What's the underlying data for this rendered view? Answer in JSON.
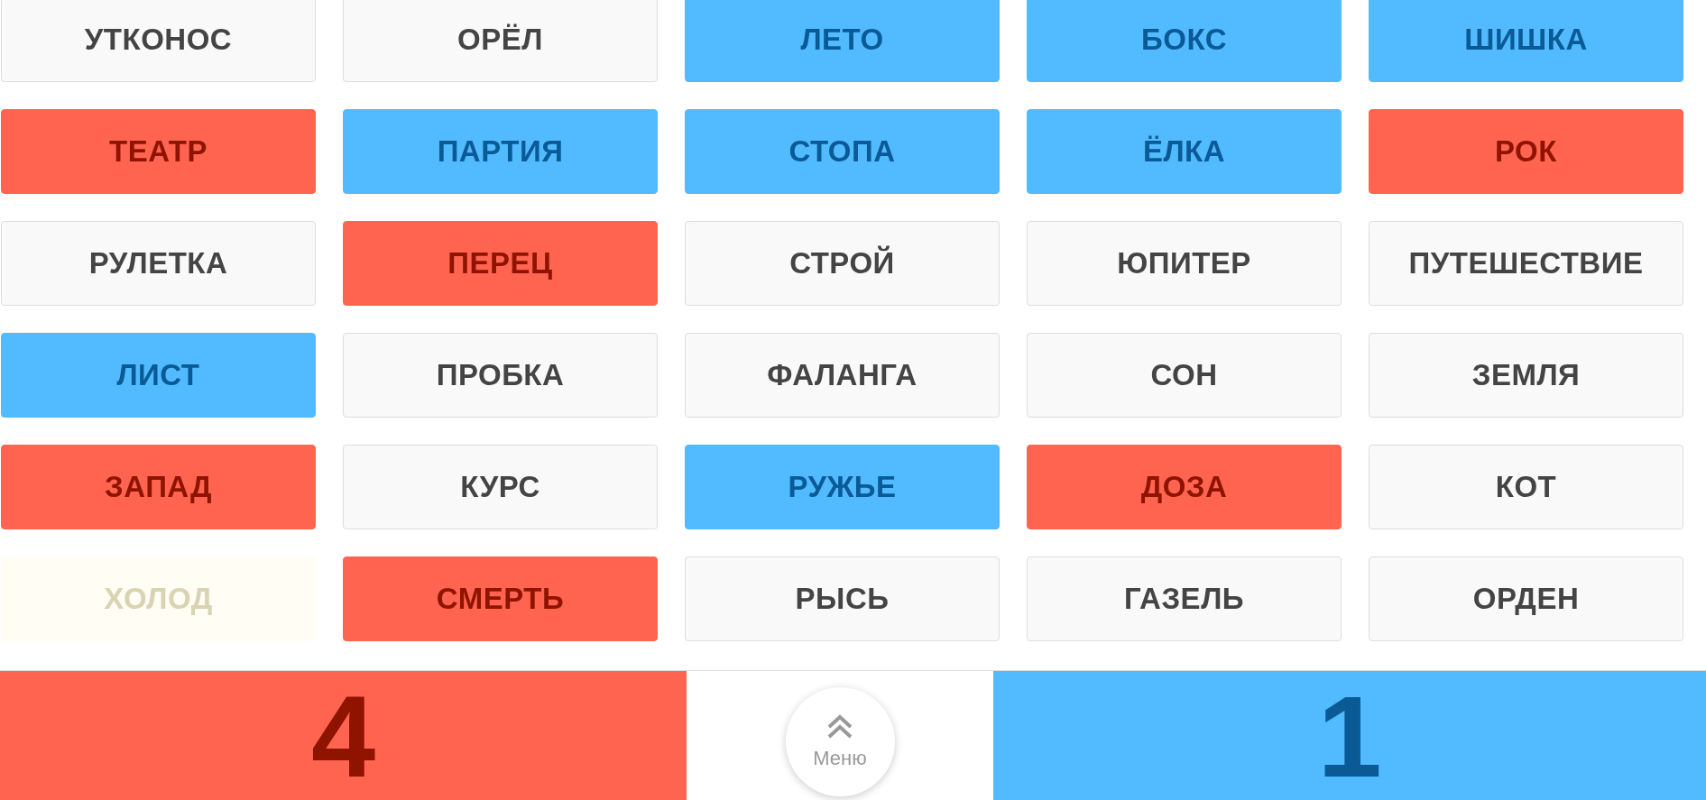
{
  "cards": [
    {
      "word": "УТКОНОС",
      "kind": "neutral"
    },
    {
      "word": "ОРЁЛ",
      "kind": "neutral"
    },
    {
      "word": "ЛЕТО",
      "kind": "blue"
    },
    {
      "word": "БОКС",
      "kind": "blue"
    },
    {
      "word": "ШИШКА",
      "kind": "blue"
    },
    {
      "word": "ТЕАТР",
      "kind": "red"
    },
    {
      "word": "ПАРТИЯ",
      "kind": "blue"
    },
    {
      "word": "СТОПА",
      "kind": "blue"
    },
    {
      "word": "ЁЛКА",
      "kind": "blue"
    },
    {
      "word": "РОК",
      "kind": "red"
    },
    {
      "word": "РУЛЕТКА",
      "kind": "neutral"
    },
    {
      "word": "ПЕРЕЦ",
      "kind": "red"
    },
    {
      "word": "СТРОЙ",
      "kind": "neutral"
    },
    {
      "word": "ЮПИТЕР",
      "kind": "neutral"
    },
    {
      "word": "ПУТЕШЕСТВИЕ",
      "kind": "neutral"
    },
    {
      "word": "ЛИСТ",
      "kind": "blue"
    },
    {
      "word": "ПРОБКА",
      "kind": "neutral"
    },
    {
      "word": "ФАЛАНГА",
      "kind": "neutral"
    },
    {
      "word": "СОН",
      "kind": "neutral"
    },
    {
      "word": "ЗЕМЛЯ",
      "kind": "neutral"
    },
    {
      "word": "ЗАПАД",
      "kind": "red"
    },
    {
      "word": "КУРС",
      "kind": "neutral"
    },
    {
      "word": "РУЖЬЕ",
      "kind": "blue"
    },
    {
      "word": "ДОЗА",
      "kind": "red"
    },
    {
      "word": "КОТ",
      "kind": "neutral"
    },
    {
      "word": "ХОЛОД",
      "kind": "faded"
    },
    {
      "word": "СМЕРТЬ",
      "kind": "red"
    },
    {
      "word": "РЫСЬ",
      "kind": "neutral"
    },
    {
      "word": "ГАЗЕЛЬ",
      "kind": "neutral"
    },
    {
      "word": "ОРДЕН",
      "kind": "neutral"
    }
  ],
  "scores": {
    "red": "4",
    "blue": "1"
  },
  "menu_button": {
    "label": "Меню"
  }
}
